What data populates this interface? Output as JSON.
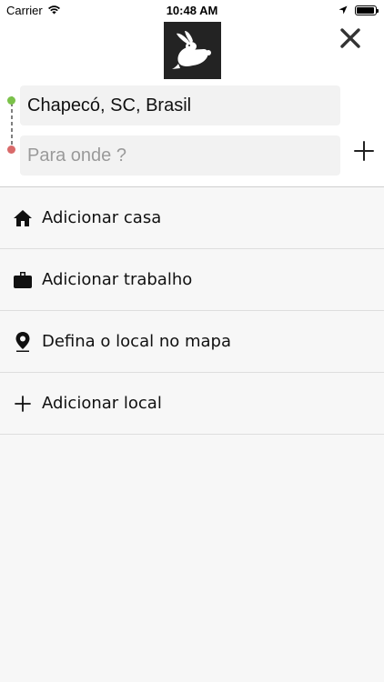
{
  "status_bar": {
    "carrier": "Carrier",
    "time": "10:48 AM",
    "battery_level": 0.95
  },
  "header": {
    "logo_icon": "rabbit-logo-icon",
    "close_icon": "close-icon"
  },
  "route": {
    "origin_value": "Chapecó, SC, Brasil",
    "destination_placeholder": "Para onde ?",
    "origin_dot_color": "#7bc24a",
    "destination_dot_color": "#d96a6a",
    "add_stop_icon": "plus-icon"
  },
  "list": {
    "items": [
      {
        "label": "Adicionar casa",
        "icon": "home-icon"
      },
      {
        "label": "Adicionar trabalho",
        "icon": "briefcase-icon"
      },
      {
        "label": "Defina o local no mapa",
        "icon": "map-pin-icon"
      },
      {
        "label": "Adicionar local",
        "icon": "plus-icon"
      }
    ]
  }
}
